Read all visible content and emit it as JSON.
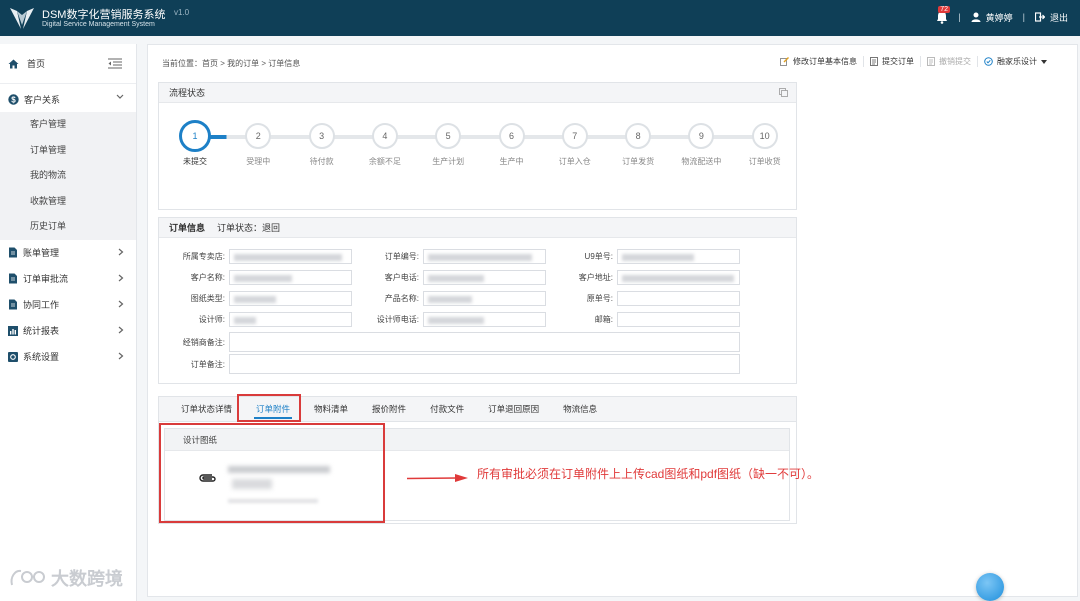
{
  "app": {
    "title": "DSM数字化营销服务系统",
    "subtitle": "Digital Service Management System",
    "version": "v1.0",
    "notification_count": "72",
    "username": "黄婷婷",
    "logout": "退出",
    "header_color": "#0f3f57"
  },
  "sidebar": {
    "home": "首页",
    "customer_relation": {
      "label": "客户关系",
      "items": [
        "客户管理",
        "订单管理",
        "我的物流",
        "收款管理",
        "历史订单"
      ]
    },
    "groups": [
      "账单管理",
      "订单审批流",
      "协同工作",
      "统计报表",
      "系统设置"
    ]
  },
  "breadcrumb": "当前位置：首页 > 我的订单 > 订单信息",
  "actions": {
    "edit": "修改订单基本信息",
    "submit": "提交订单",
    "revoke": "撤销提交",
    "design": "融家乐设计"
  },
  "flow": {
    "title": "流程状态",
    "current_step": 1,
    "steps": [
      {
        "num": "1",
        "label": "未提交"
      },
      {
        "num": "2",
        "label": "受理中"
      },
      {
        "num": "3",
        "label": "待付款"
      },
      {
        "num": "4",
        "label": "余额不足"
      },
      {
        "num": "5",
        "label": "生产计划"
      },
      {
        "num": "6",
        "label": "生产中"
      },
      {
        "num": "7",
        "label": "订单入仓"
      },
      {
        "num": "8",
        "label": "订单发货"
      },
      {
        "num": "9",
        "label": "物流配送中"
      },
      {
        "num": "10",
        "label": "订单收货"
      }
    ]
  },
  "order_info": {
    "title": "订单信息",
    "status": "订单状态：退回",
    "fields": {
      "store": "所属专卖店:",
      "order_no": "订单编号:",
      "u9_no": "U9单号:",
      "customer_name": "客户名称:",
      "customer_phone": "客户电话:",
      "customer_address": "客户地址:",
      "drawing_type": "图纸类型:",
      "product_name": "产品名称:",
      "original_no": "原单号:",
      "designer": "设计师:",
      "designer_phone": "设计师电话:",
      "email": "邮箱:",
      "dealer_note": "经销商备注:",
      "order_note": "订单备注:"
    }
  },
  "tabs": {
    "items": [
      "订单状态详情",
      "订单附件",
      "物料清单",
      "报价附件",
      "付款文件",
      "订单退回原因",
      "物流信息"
    ],
    "active_index": 1
  },
  "attachments": {
    "section": "设计图纸"
  },
  "annotation": {
    "text": "所有审批必须在订单附件上上传cad图纸和pdf图纸（缺一不可）。",
    "color": "#e03a3a"
  },
  "watermark": "大数跨境"
}
